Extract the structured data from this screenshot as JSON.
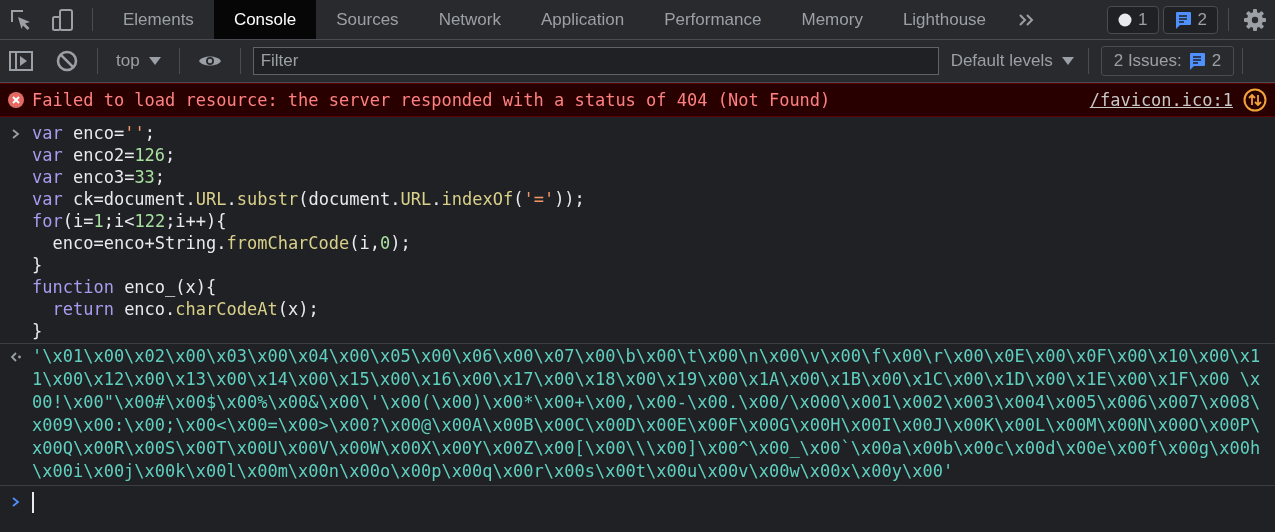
{
  "main_toolbar": {
    "tabs": [
      {
        "label": "Elements",
        "selected": false
      },
      {
        "label": "Console",
        "selected": true
      },
      {
        "label": "Sources",
        "selected": false
      },
      {
        "label": "Network",
        "selected": false
      },
      {
        "label": "Application",
        "selected": false
      },
      {
        "label": "Performance",
        "selected": false
      },
      {
        "label": "Memory",
        "selected": false
      },
      {
        "label": "Lighthouse",
        "selected": false
      }
    ],
    "badges": [
      {
        "kind": "info",
        "count": "1"
      },
      {
        "kind": "issues",
        "count": "2"
      }
    ]
  },
  "console_toolbar": {
    "context": "top",
    "filter": {
      "placeholder": "Filter"
    },
    "levels": "Default levels",
    "issues": {
      "label": "2 Issues:",
      "count": "2"
    }
  },
  "messages": [
    {
      "kind": "error",
      "text": "Failed to load resource: the server responded with a status of 404 (Not Found)",
      "source": "/favicon.ico:1"
    },
    {
      "kind": "input",
      "lines": [
        {
          "tokens": [
            {
              "kind": "keyword",
              "text": "var"
            },
            {
              "kind": "plain",
              "text": " enco="
            },
            {
              "kind": "string",
              "text": "''"
            },
            {
              "kind": "plain",
              "text": ";"
            }
          ]
        },
        {
          "tokens": [
            {
              "kind": "keyword",
              "text": "var"
            },
            {
              "kind": "plain",
              "text": " enco2="
            },
            {
              "kind": "number",
              "text": "126"
            },
            {
              "kind": "plain",
              "text": ";"
            }
          ]
        },
        {
          "tokens": [
            {
              "kind": "keyword",
              "text": "var"
            },
            {
              "kind": "plain",
              "text": " enco3="
            },
            {
              "kind": "number",
              "text": "33"
            },
            {
              "kind": "plain",
              "text": ";"
            }
          ]
        },
        {
          "tokens": [
            {
              "kind": "keyword",
              "text": "var"
            },
            {
              "kind": "plain",
              "text": " ck=document."
            },
            {
              "kind": "property",
              "text": "URL"
            },
            {
              "kind": "plain",
              "text": "."
            },
            {
              "kind": "property",
              "text": "substr"
            },
            {
              "kind": "plain",
              "text": "(document."
            },
            {
              "kind": "property",
              "text": "URL"
            },
            {
              "kind": "plain",
              "text": "."
            },
            {
              "kind": "property",
              "text": "indexOf"
            },
            {
              "kind": "plain",
              "text": "("
            },
            {
              "kind": "string",
              "text": "'='"
            },
            {
              "kind": "plain",
              "text": "));"
            }
          ]
        },
        {
          "tokens": [
            {
              "kind": "keyword",
              "text": "for"
            },
            {
              "kind": "plain",
              "text": "(i="
            },
            {
              "kind": "number",
              "text": "1"
            },
            {
              "kind": "plain",
              "text": ";i<"
            },
            {
              "kind": "number",
              "text": "122"
            },
            {
              "kind": "plain",
              "text": ";i++){"
            }
          ]
        },
        {
          "indented": true,
          "tokens": [
            {
              "kind": "plain",
              "text": "enco=enco+String."
            },
            {
              "kind": "property",
              "text": "fromCharCode"
            },
            {
              "kind": "plain",
              "text": "(i,"
            },
            {
              "kind": "number",
              "text": "0"
            },
            {
              "kind": "plain",
              "text": ");"
            }
          ]
        },
        {
          "tokens": [
            {
              "kind": "plain",
              "text": "}"
            }
          ]
        },
        {
          "tokens": [
            {
              "kind": "keyword",
              "text": "function"
            },
            {
              "kind": "plain",
              "text": " enco_(x){"
            }
          ]
        },
        {
          "indented": true,
          "tokens": [
            {
              "kind": "keyword",
              "text": "return"
            },
            {
              "kind": "plain",
              "text": " enco."
            },
            {
              "kind": "property",
              "text": "charCodeAt"
            },
            {
              "kind": "plain",
              "text": "(x);"
            }
          ]
        },
        {
          "tokens": [
            {
              "kind": "plain",
              "text": "}"
            }
          ]
        }
      ]
    },
    {
      "kind": "result",
      "text": "'\\x01\\x00\\x02\\x00\\x03\\x00\\x04\\x00\\x05\\x00\\x06\\x00\\x07\\x00\\b\\x00\\t\\x00\\n\\x00\\v\\x00\\f\\x00\\r\\x00\\x0E\\x00\\x0F\\x00\\x10\\x00\\x11\\x00\\x12\\x00\\x13\\x00\\x14\\x00\\x15\\x00\\x16\\x00\\x17\\x00\\x18\\x00\\x19\\x00\\x1A\\x00\\x1B\\x00\\x1C\\x00\\x1D\\x00\\x1E\\x00\\x1F\\x00 \\x00!\\x00\"\\x00#\\x00$\\x00%\\x00&\\x00\\'\\x00(\\x00)\\x00*\\x00+\\x00,\\x00-\\x00.\\x00/\\x000\\x001\\x002\\x003\\x004\\x005\\x006\\x007\\x008\\x009\\x00:\\x00;\\x00<\\x00=\\x00>\\x00?\\x00@\\x00A\\x00B\\x00C\\x00D\\x00E\\x00F\\x00G\\x00H\\x00I\\x00J\\x00K\\x00L\\x00M\\x00N\\x00O\\x00P\\x00Q\\x00R\\x00S\\x00T\\x00U\\x00V\\x00W\\x00X\\x00Y\\x00Z\\x00[\\x00\\\\\\x00]\\x00^\\x00_\\x00`\\x00a\\x00b\\x00c\\x00d\\x00e\\x00f\\x00g\\x00h\\x00i\\x00j\\x00k\\x00l\\x00m\\x00n\\x00o\\x00p\\x00q\\x00r\\x00s\\x00t\\x00u\\x00v\\x00w\\x00x\\x00y\\x00'"
    }
  ]
}
